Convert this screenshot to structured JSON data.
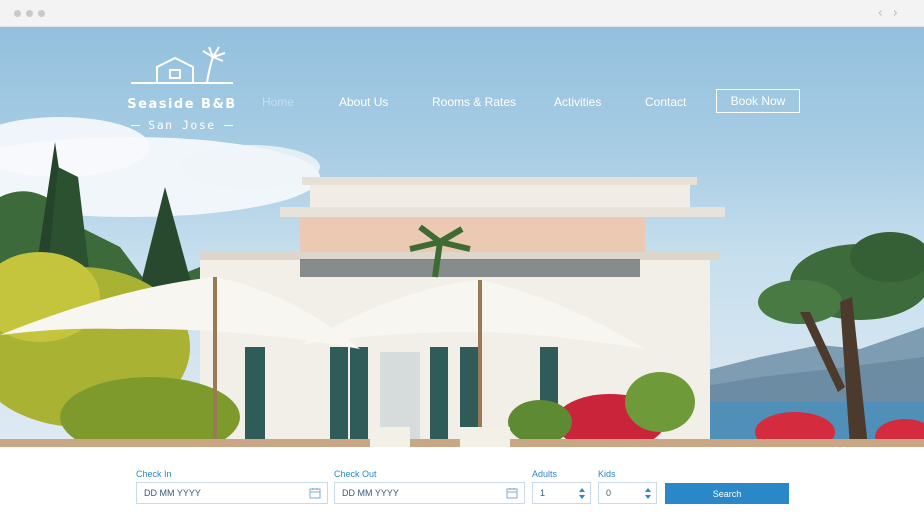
{
  "brand": {
    "name": "Seaside B&B",
    "location": "San Jose",
    "logo_icon": "house-and-palm-icon"
  },
  "nav": {
    "items": [
      {
        "label": "Home",
        "active": true
      },
      {
        "label": "About Us",
        "active": false
      },
      {
        "label": "Rooms & Rates",
        "active": false
      },
      {
        "label": "Activities",
        "active": false
      },
      {
        "label": "Contact",
        "active": false
      }
    ],
    "book_label": "Book Now"
  },
  "booking": {
    "check_in": {
      "label": "Check In",
      "placeholder": "DD MM YYYY",
      "icon": "calendar-icon"
    },
    "check_out": {
      "label": "Check Out",
      "placeholder": "DD MM YYYY",
      "icon": "calendar-icon"
    },
    "adults": {
      "label": "Adults",
      "value": "1"
    },
    "kids": {
      "label": "Kids",
      "value": "0"
    },
    "search_label": "Search"
  },
  "colors": {
    "accent": "#2a87c8",
    "nav_active": "#bfe0f5",
    "text": "#ffffff"
  }
}
